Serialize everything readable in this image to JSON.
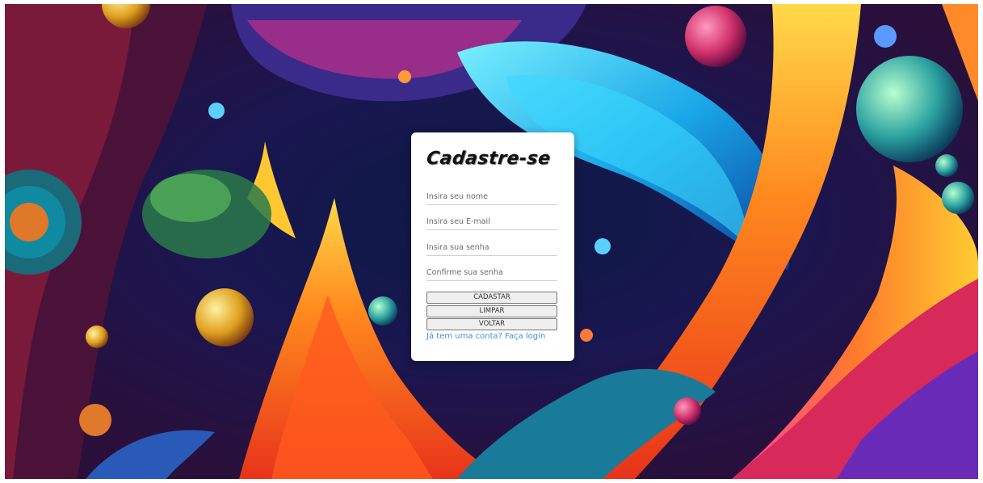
{
  "form": {
    "title": "Cadastre-se",
    "name_placeholder": "Insira seu nome",
    "email_placeholder": "Insira seu E-mail",
    "password_placeholder": "Insira sua senha",
    "confirm_placeholder": "Confirme sua senha",
    "register_label": "CADASTAR",
    "clear_label": "LIMPAR",
    "back_label": "VOLTAR",
    "login_link": "Já tem uma conta? Faça login"
  },
  "colors": {
    "link": "#3e8fe0",
    "card_bg": "#ffffff",
    "button_bg": "#efefef"
  }
}
